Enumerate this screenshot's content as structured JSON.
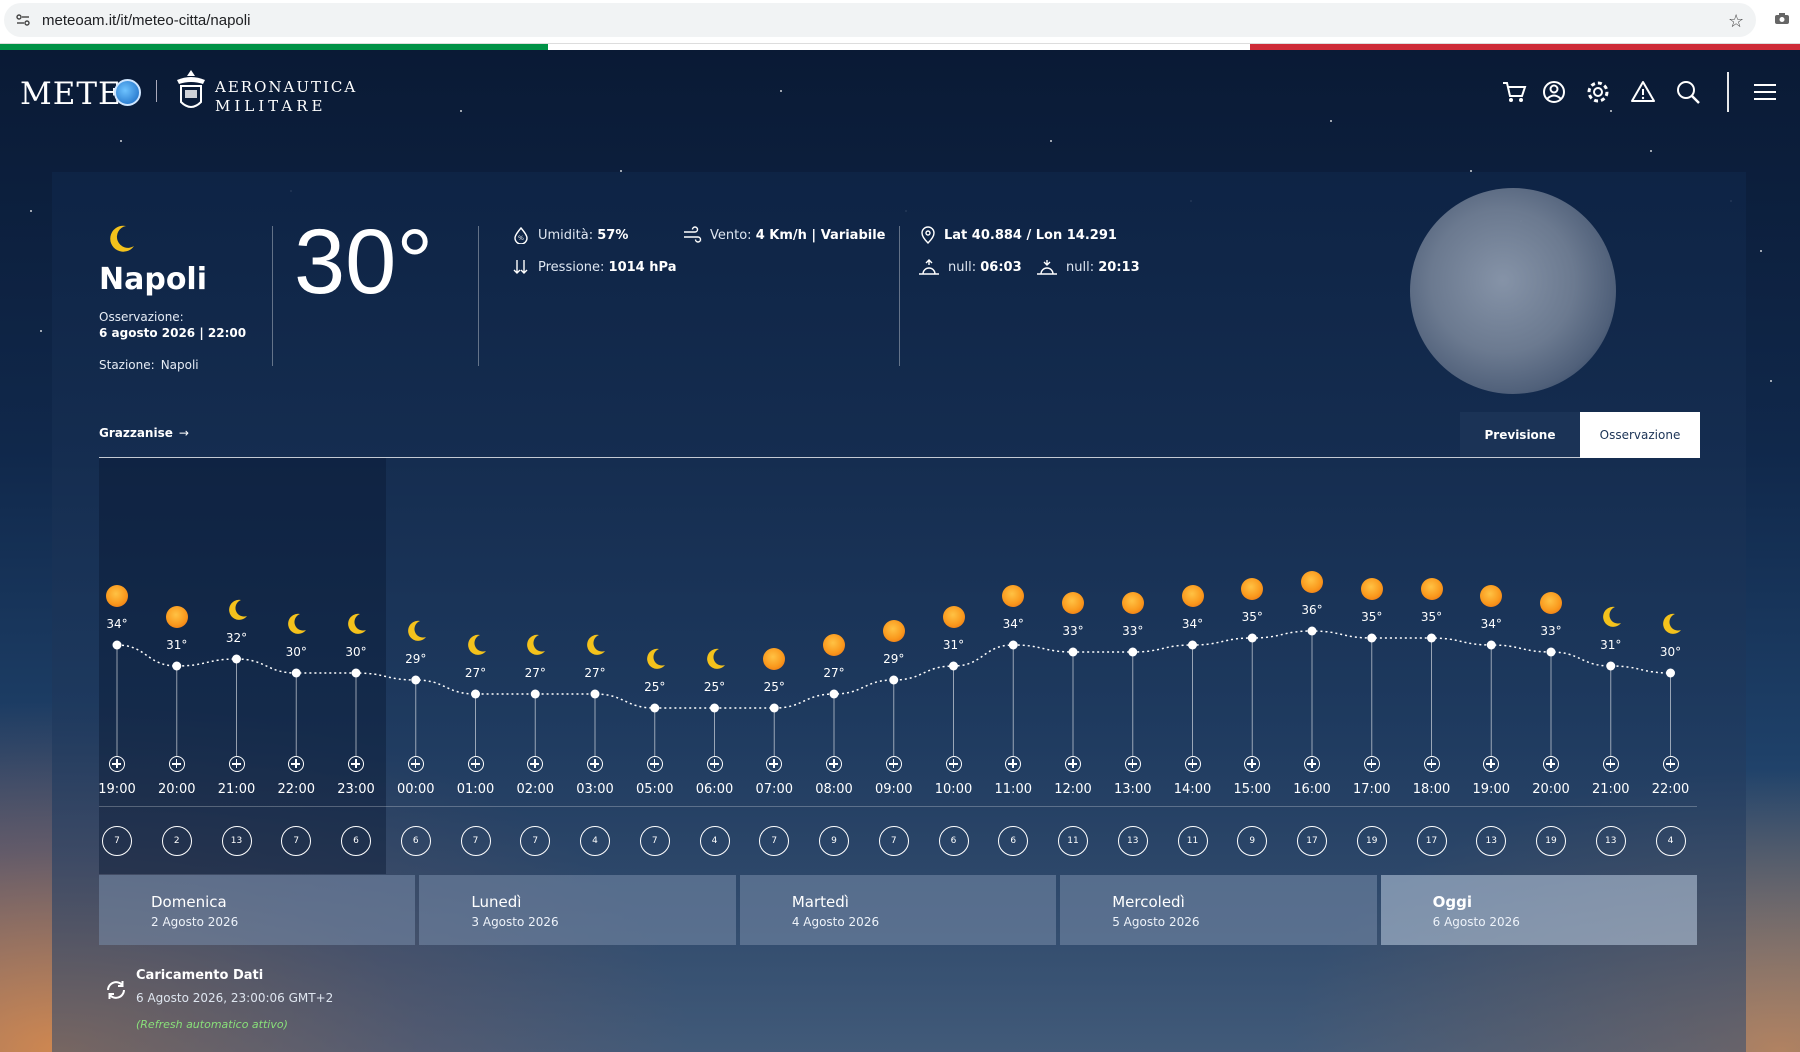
{
  "browser": {
    "url": "meteoam.it/it/meteo-citta/napoli"
  },
  "colors": {
    "it_green": "#009246",
    "it_white": "#ffffff",
    "it_red": "#ce2b37",
    "accent_auto": "#89e07a"
  },
  "brand": {
    "meteo": "METE",
    "am_line1": "AERONAUTICA",
    "am_line2": "MILITARE"
  },
  "header_icons": [
    "cart-icon",
    "user-icon",
    "gear-icon",
    "warning-icon",
    "search-icon",
    "menu-icon"
  ],
  "current": {
    "icon": "moon-icon",
    "city": "Napoli",
    "obs_label": "Osservazione:",
    "obs_value": "6 agosto 2026 | 22:00",
    "station_label": "Stazione:",
    "station_value": "Napoli",
    "temperature": "30°",
    "humidity_label": "Umidità:",
    "humidity_value": "57%",
    "wind_label": "Vento:",
    "wind_value": "4 Km/h | Variabile",
    "pressure_label": "Pressione:",
    "pressure_value": "1014 hPa",
    "coords": "Lat 40.884 / Lon 14.291",
    "sunrise_label": "null:",
    "sunrise_value": "06:03",
    "sunset_label": "null:",
    "sunset_value": "20:13"
  },
  "nearby_link": "Grazzanise",
  "tabs": {
    "forecast": "Previsione",
    "observation": "Osservazione"
  },
  "chart_data": {
    "type": "line",
    "hours": [
      "19:00",
      "20:00",
      "21:00",
      "22:00",
      "23:00",
      "00:00",
      "01:00",
      "02:00",
      "03:00",
      "05:00",
      "06:00",
      "07:00",
      "08:00",
      "09:00",
      "10:00",
      "11:00",
      "12:00",
      "13:00",
      "14:00",
      "15:00",
      "16:00",
      "17:00",
      "18:00",
      "19:00",
      "20:00",
      "21:00",
      "22:00"
    ],
    "temps": [
      34,
      31,
      32,
      30,
      30,
      29,
      27,
      27,
      27,
      25,
      25,
      25,
      27,
      29,
      31,
      34,
      33,
      33,
      34,
      35,
      36,
      35,
      35,
      34,
      33,
      31,
      30
    ],
    "icons": [
      "sun",
      "sun",
      "moon",
      "moon",
      "moon",
      "moon",
      "moon",
      "moon",
      "moon",
      "moon",
      "moon",
      "sun",
      "sun",
      "sun",
      "sun",
      "sun",
      "sun",
      "sun",
      "sun",
      "sun",
      "sun",
      "sun",
      "sun",
      "sun",
      "sun",
      "moon",
      "moon"
    ],
    "wind_speed": [
      7,
      2,
      13,
      7,
      6,
      6,
      7,
      7,
      4,
      7,
      4,
      7,
      9,
      7,
      6,
      6,
      11,
      13,
      11,
      9,
      17,
      19,
      17,
      13,
      19,
      13,
      4
    ],
    "unit": "°"
  },
  "days": [
    {
      "name": "Domenica",
      "date": "2 Agosto 2026"
    },
    {
      "name": "Lunedì",
      "date": "3 Agosto 2026"
    },
    {
      "name": "Martedì",
      "date": "4 Agosto 2026"
    },
    {
      "name": "Mercoledì",
      "date": "5 Agosto 2026"
    },
    {
      "name": "Oggi",
      "date": "6 Agosto 2026"
    }
  ],
  "status": {
    "title": "Caricamento Dati",
    "time": "6 Agosto 2026, 23:00:06 GMT+2",
    "auto": "(Refresh automatico attivo)"
  }
}
